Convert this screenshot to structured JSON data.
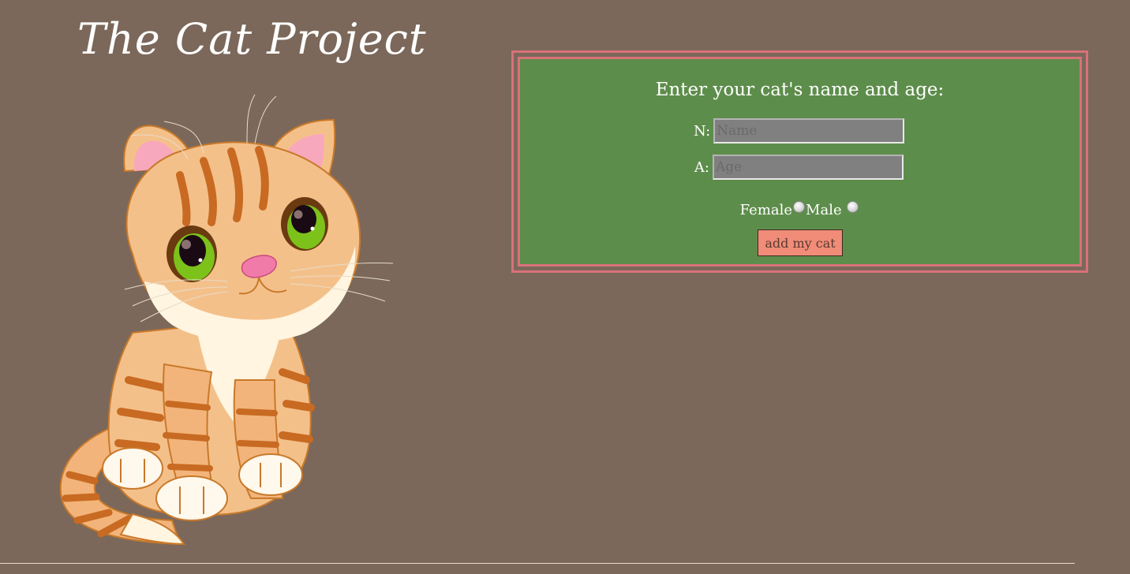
{
  "header": {
    "site_title": "The Cat Project"
  },
  "illustration": {
    "name": "kitten-illustration",
    "icon": "cat-icon"
  },
  "form": {
    "heading": "Enter your cat's name and age:",
    "name_label": "N:",
    "name_placeholder": "Name",
    "name_value": "",
    "age_label": "A:",
    "age_placeholder": "Age",
    "age_value": "",
    "gender_options": [
      {
        "label": "Female",
        "selected": false
      },
      {
        "label": "Male",
        "selected": false
      }
    ],
    "submit_label": "add my cat"
  },
  "colors": {
    "page_background": "#7b685a",
    "form_background": "#5d8d4b",
    "form_border": "#d9717a",
    "button_background": "#f08c78"
  }
}
